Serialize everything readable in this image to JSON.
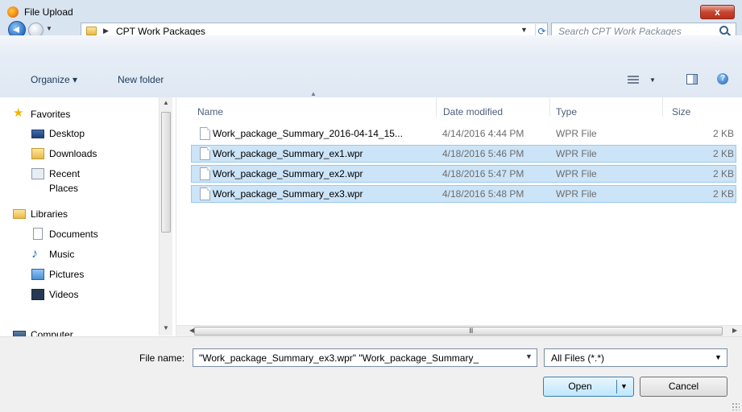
{
  "window": {
    "title": "File Upload",
    "close_glyph": "x"
  },
  "address": {
    "path": "CPT Work Packages"
  },
  "search": {
    "placeholder": "Search CPT Work Packages"
  },
  "toolbar": {
    "organize_label": "Organize ▾",
    "new_folder_label": "New folder",
    "help_glyph": "?"
  },
  "nav": {
    "favorites": "Favorites",
    "desktop": "Desktop",
    "downloads": "Downloads",
    "recent_places": "Recent Places",
    "libraries": "Libraries",
    "documents": "Documents",
    "music": "Music",
    "pictures": "Pictures",
    "videos": "Videos",
    "computer": "Computer"
  },
  "columns": {
    "name": "Name",
    "date_modified": "Date modified",
    "type": "Type",
    "size": "Size"
  },
  "files": [
    {
      "name": "Work_package_Summary_2016-04-14_15...",
      "date": "4/14/2016 4:44 PM",
      "type": "WPR File",
      "size": "2 KB",
      "selected": false
    },
    {
      "name": "Work_package_Summary_ex1.wpr",
      "date": "4/18/2016 5:46 PM",
      "type": "WPR File",
      "size": "2 KB",
      "selected": true
    },
    {
      "name": "Work_package_Summary_ex2.wpr",
      "date": "4/18/2016 5:47 PM",
      "type": "WPR File",
      "size": "2 KB",
      "selected": true
    },
    {
      "name": "Work_package_Summary_ex3.wpr",
      "date": "4/18/2016 5:48 PM",
      "type": "WPR File",
      "size": "2 KB",
      "selected": true
    }
  ],
  "footer": {
    "file_name_label": "File name:",
    "file_name_value": "\"Work_package_Summary_ex3.wpr\" \"Work_package_Summary_",
    "filter_value": "All Files (*.*)",
    "open_label": "Open",
    "cancel_label": "Cancel"
  },
  "colors": {
    "selection": "#cce4f7",
    "selection_border": "#99c9ef",
    "titlebar": "#d9e4f1"
  }
}
